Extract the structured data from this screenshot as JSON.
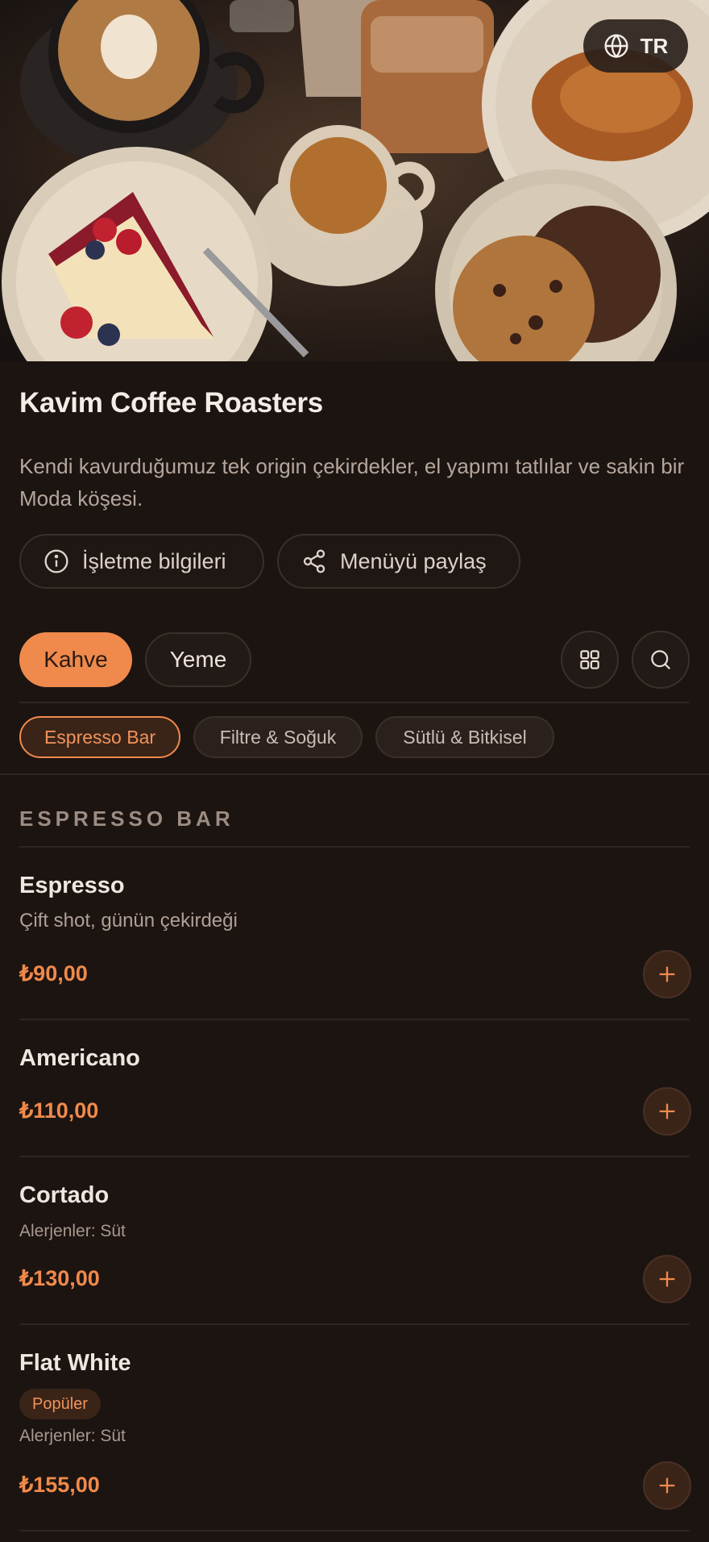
{
  "header": {
    "language_label": "TR",
    "title": "Kavim Coffee Roasters",
    "description": "Kendi kavurduğumuz tek origin çekirdekler, el yapımı tatlılar ve sakin bir Moda köşesi.",
    "info_button": "İşletme bilgileri",
    "share_button": "Menüyü paylaş"
  },
  "tabs": [
    {
      "label": "Kahve",
      "active": true
    },
    {
      "label": "Yeme",
      "active": false
    }
  ],
  "chips": [
    {
      "label": "Espresso Bar",
      "active": true
    },
    {
      "label": "Filtre & Soğuk",
      "active": false
    },
    {
      "label": "Sütlü & Bitkisel",
      "active": false
    }
  ],
  "section": {
    "title": "ESPRESSO BAR"
  },
  "items": [
    {
      "name": "Espresso",
      "subtitle": "Çift shot, günün çekirdeği",
      "price": "₺90,00"
    },
    {
      "name": "Americano",
      "price": "₺110,00"
    },
    {
      "name": "Cortado",
      "allergens": "Alerjenler: Süt",
      "price": "₺130,00"
    },
    {
      "name": "Flat White",
      "badge": "Popüler",
      "allergens": "Alerjenler: Süt",
      "price": "₺155,00"
    }
  ],
  "colors": {
    "accent": "#ef8a4c",
    "background": "#1c1411"
  }
}
